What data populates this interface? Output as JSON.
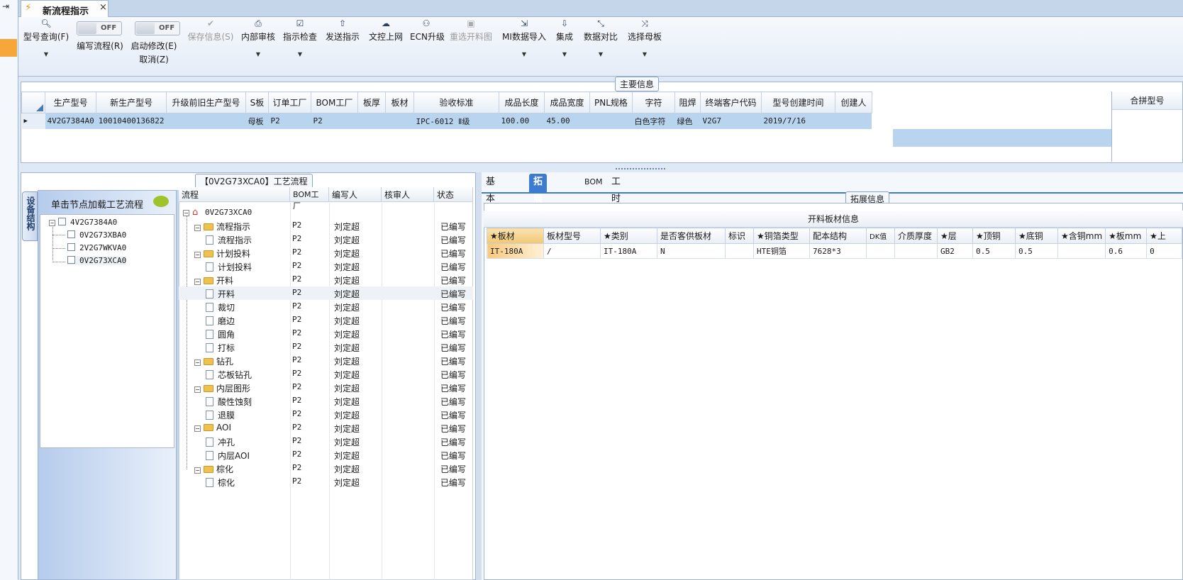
{
  "window": {
    "tab_title": "新流程指示",
    "tab_close": "×"
  },
  "toolbar": {
    "items": [
      {
        "label": "型号查询(F)",
        "icon": "search-icon"
      },
      {
        "label": "编写流程(R)",
        "toggle": "OFF"
      },
      {
        "label": "启动修改(E)",
        "label2": "取消(Z)",
        "toggle": "OFF"
      },
      {
        "label": "保存信息(S)",
        "icon": "check-icon",
        "disabled": true
      },
      {
        "label": "内部审核",
        "icon": "printer-icon"
      },
      {
        "label": "指示检查",
        "icon": "checkbox-icon"
      },
      {
        "label": "发送指示",
        "icon": "upload-icon"
      },
      {
        "label": "文控上网",
        "icon": "cloud-upload-icon"
      },
      {
        "label": "ECN升级",
        "icon": "people-icon"
      },
      {
        "label": "重选开料图",
        "icon": "image-icon",
        "disabled": true
      },
      {
        "label": "MI数据导入",
        "icon": "import-icon"
      },
      {
        "label": "集成",
        "icon": "download-icon"
      },
      {
        "label": "数据对比",
        "icon": "compress-icon"
      },
      {
        "label": "选择母板",
        "icon": "shuffle-icon"
      }
    ]
  },
  "main_info": {
    "title": "主要信息",
    "columns": [
      "生产型号",
      "新生产型号",
      "升级前旧生产型号",
      "S板",
      "订单工厂",
      "BOM工厂",
      "板厚",
      "板材",
      "验收标准",
      "成品长度",
      "成品宽度",
      "PNL规格",
      "字符",
      "阻焊",
      "终端客户代码",
      "型号创建时间",
      "创建人"
    ],
    "row": [
      "4V2G7384A0",
      "10010400136822",
      "",
      "母板",
      "P2",
      "P2",
      "",
      "",
      "IPC-6012 Ⅱ级",
      "100.00",
      "45.00",
      "",
      "白色字符",
      "绿色",
      "V2G7",
      "2019/7/16",
      ""
    ],
    "merge_header": "合拼型号"
  },
  "device": {
    "vtab": "设备结构",
    "hint": "单击节点加载工艺流程",
    "tree": [
      {
        "label": "4V2G7384A0",
        "level": 0
      },
      {
        "label": "0V2G73XBA0",
        "level": 1
      },
      {
        "label": "2V2G7WKVA0",
        "level": 1
      },
      {
        "label": "0V2G73XCA0",
        "level": 1
      }
    ]
  },
  "process": {
    "title": "【0V2G73XCA0】工艺流程",
    "columns": [
      "流程",
      "BOM工厂",
      "编写人",
      "核审人",
      "状态"
    ],
    "root": "0V2G73XCA0",
    "rows": [
      {
        "name": "流程指示",
        "type": "folder",
        "bom": "P2",
        "writer": "刘定超",
        "status": "已编写"
      },
      {
        "name": "流程指示",
        "type": "doc",
        "bom": "P2",
        "writer": "刘定超",
        "status": "已编写"
      },
      {
        "name": "计划投料",
        "type": "folder",
        "bom": "P2",
        "writer": "刘定超",
        "status": "已编写"
      },
      {
        "name": "计划投料",
        "type": "doc",
        "bom": "P2",
        "writer": "刘定超",
        "status": "已编写"
      },
      {
        "name": "开料",
        "type": "folder",
        "bom": "P2",
        "writer": "刘定超",
        "status": "已编写"
      },
      {
        "name": "开料",
        "type": "doc",
        "bom": "P2",
        "writer": "刘定超",
        "status": "已编写",
        "selected": true
      },
      {
        "name": "裁切",
        "type": "doc",
        "bom": "P2",
        "writer": "刘定超",
        "status": "已编写"
      },
      {
        "name": "磨边",
        "type": "doc",
        "bom": "P2",
        "writer": "刘定超",
        "status": "已编写"
      },
      {
        "name": "圆角",
        "type": "doc",
        "bom": "P2",
        "writer": "刘定超",
        "status": "已编写"
      },
      {
        "name": "打标",
        "type": "doc",
        "bom": "P2",
        "writer": "刘定超",
        "status": "已编写"
      },
      {
        "name": "钻孔",
        "type": "folder",
        "bom": "P2",
        "writer": "刘定超",
        "status": "已编写"
      },
      {
        "name": "芯板钻孔",
        "type": "doc",
        "bom": "P2",
        "writer": "刘定超",
        "status": "已编写"
      },
      {
        "name": "内层图形",
        "type": "folder",
        "bom": "P2",
        "writer": "刘定超",
        "status": "已编写"
      },
      {
        "name": "酸性蚀刻",
        "type": "doc",
        "bom": "P2",
        "writer": "刘定超",
        "status": "已编写"
      },
      {
        "name": "退膜",
        "type": "doc",
        "bom": "P2",
        "writer": "刘定超",
        "status": "已编写"
      },
      {
        "name": "AOI",
        "type": "folder",
        "bom": "P2",
        "writer": "刘定超",
        "status": "已编写"
      },
      {
        "name": "冲孔",
        "type": "doc",
        "bom": "P2",
        "writer": "刘定超",
        "status": "已编写"
      },
      {
        "name": "内层AOI",
        "type": "doc",
        "bom": "P2",
        "writer": "刘定超",
        "status": "已编写"
      },
      {
        "name": "棕化",
        "type": "folder",
        "bom": "P2",
        "writer": "刘定超",
        "status": "已编写"
      },
      {
        "name": "棕化",
        "type": "doc",
        "bom": "P2",
        "writer": "刘定超",
        "status": "已编写"
      }
    ]
  },
  "right": {
    "tabs": [
      "基本信息",
      "拓展信息",
      "BOM",
      "工时"
    ],
    "active_tab": 1,
    "ext_title": "拓展信息",
    "caption": "开料板材信息",
    "columns": [
      "★板材",
      "板材型号",
      "★类别",
      "是否客供板材",
      "标识",
      "★铜箔类型",
      "配本结构",
      "DK值",
      "介质厚度",
      "★层",
      "★顶铜",
      "★底铜",
      "★含铜mm",
      "★板mm",
      "★上"
    ],
    "row": [
      "IT-180A",
      "/",
      "IT-180A",
      "N",
      "",
      "HTE铜箔",
      "7628*3",
      "",
      "",
      "GB2",
      "0.5",
      "0.5",
      "",
      "0.6",
      "0"
    ]
  },
  "colors": {
    "accent": "#3d7bd0",
    "selected_row": "#b9d4ef",
    "highlight": "#f2c774"
  }
}
